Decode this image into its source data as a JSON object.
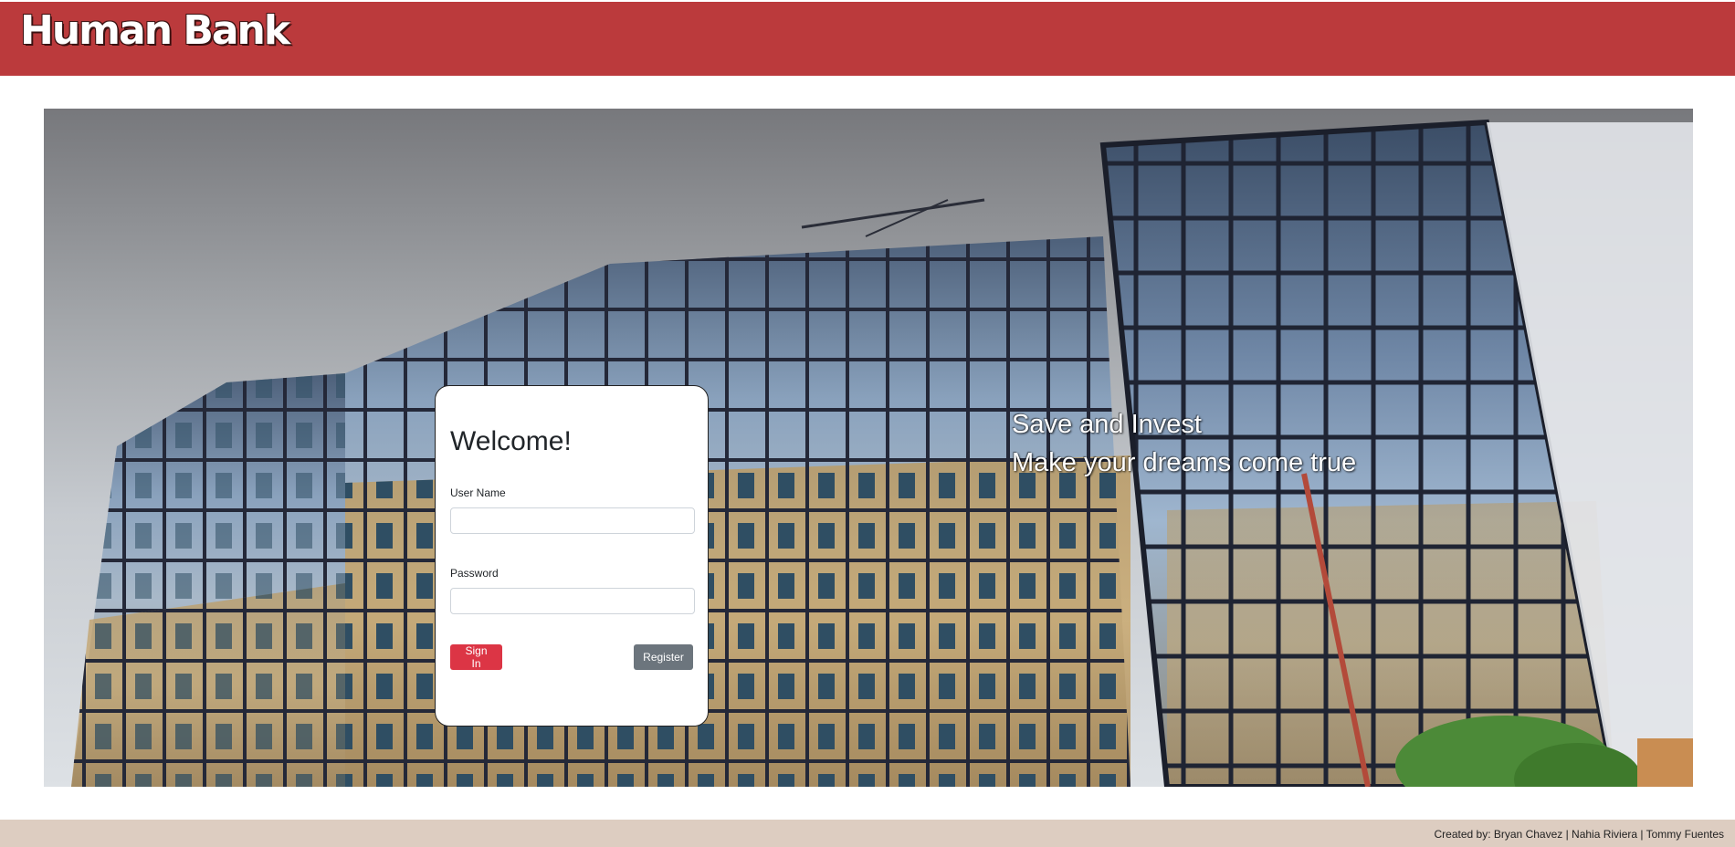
{
  "header": {
    "brand": "Human Bank",
    "color": "#bb3a3c"
  },
  "hero": {
    "image": "glass-office-building-photo",
    "tagline_line1": "Save and Invest",
    "tagline_line2": "Make your dreams come true"
  },
  "login": {
    "title": "Welcome!",
    "username_label": "User Name",
    "username_value": "",
    "password_label": "Password",
    "password_value": "",
    "signin_label": "Sign In",
    "register_label": "Register",
    "signin_color": "#dc3545",
    "register_color": "#6c757d"
  },
  "footer": {
    "credits": "Created by: Bryan Chavez | Nahia Riviera | Tommy Fuentes",
    "color": "#ddcdc1"
  }
}
